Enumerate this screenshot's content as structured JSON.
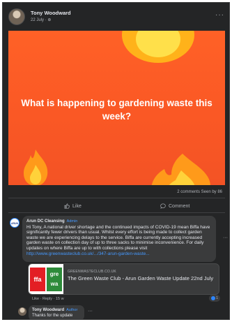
{
  "post": {
    "author": "Tony Woodward",
    "date": "22 July · ⊕",
    "more": "···",
    "banner_title": "What is happening to gardening waste this week?"
  },
  "stats": {
    "text": "2 comments  Seen by 86"
  },
  "actions": {
    "like": "Like",
    "comment": "Comment"
  },
  "comment": {
    "avatar_text": "ARUN",
    "name": "Arun DC Cleansing",
    "badge": "Admin",
    "text": "Hi Tony, A national driver shortage and the continued impacts of COVID-19 mean Biffa have significantly fewer drivers than usual. Whilst every effort is being made to collect garden waste we are experiencing delays to the service. Biffa are currently accepting increased garden waste on collection day of up to three sacks to minimise inconvenience. For daily updates on where Biffa are up to with collections please visit ",
    "link": "http://www.greenwasteclub.co.uk/.../347-arun-garden-waste...",
    "more": "···",
    "card": {
      "domain": "GREENWASTECLUB.CO.UK",
      "title": "The Green Waste Club - Arun Garden Waste Update 22nd July",
      "thumb_left": "ffa",
      "thumb_right": "gre\nwa"
    },
    "actions": "Like · Reply · 15 w",
    "reaction_count": "1"
  },
  "reply": {
    "name": "Tony Woodward",
    "badge": "Author",
    "text": "Thanks for the update",
    "more": "···"
  },
  "colors": {
    "banner": "#fa5825",
    "link": "#4599ff",
    "surface": "#242526",
    "bubble": "#3a3b3c"
  }
}
